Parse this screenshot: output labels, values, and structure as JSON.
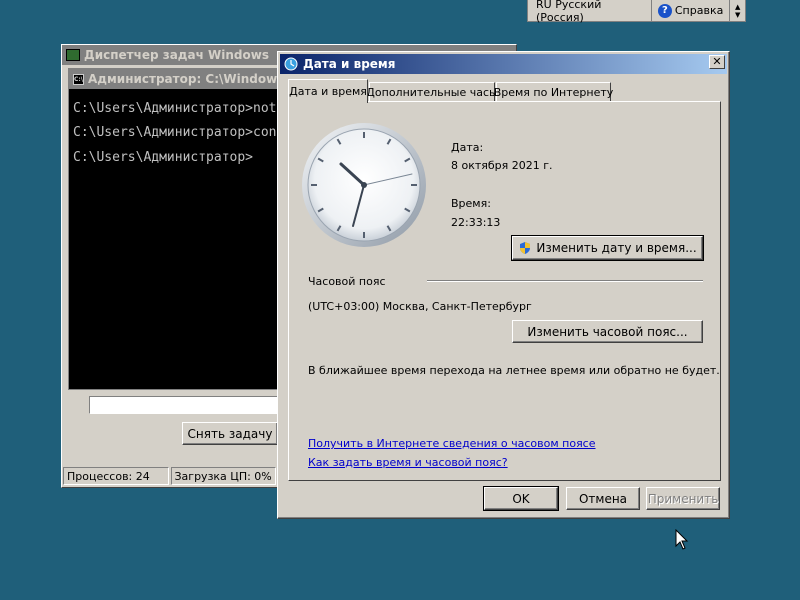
{
  "langbar": {
    "language": "RU Русский (Россия)",
    "help": "Справка"
  },
  "taskmgr": {
    "title": "Диспетчер задач Windows",
    "end_task": "Снять задачу",
    "status_processes": "Процессов: 24",
    "status_cpu": "Загрузка ЦП: 0%"
  },
  "cmd": {
    "title": "Администратор: C:\\Windows\\sys",
    "lines": [
      "C:\\Users\\Администратор>not",
      "C:\\Users\\Администратор>con",
      "C:\\Users\\Администратор>"
    ]
  },
  "dialog": {
    "title": "Дата и время",
    "tabs": [
      "Дата и время",
      "Дополнительные часы",
      "Время по Интернету"
    ],
    "date_label": "Дата:",
    "date_value": "8 октября 2021 г.",
    "time_label": "Время:",
    "time_value": "22:33:13",
    "change_datetime": "Изменить дату и время...",
    "timezone_label": "Часовой пояс",
    "timezone_value": "(UTC+03:00) Москва, Санкт-Петербург",
    "change_timezone": "Изменить часовой пояс...",
    "dst_note": "В ближайшее время перехода на летнее время или обратно не будет.",
    "link_tz_info": "Получить в Интернете сведения о часовом поясе",
    "link_howto": "Как задать время и часовой пояс?",
    "ok": "OK",
    "cancel": "Отмена",
    "apply": "Применить"
  }
}
